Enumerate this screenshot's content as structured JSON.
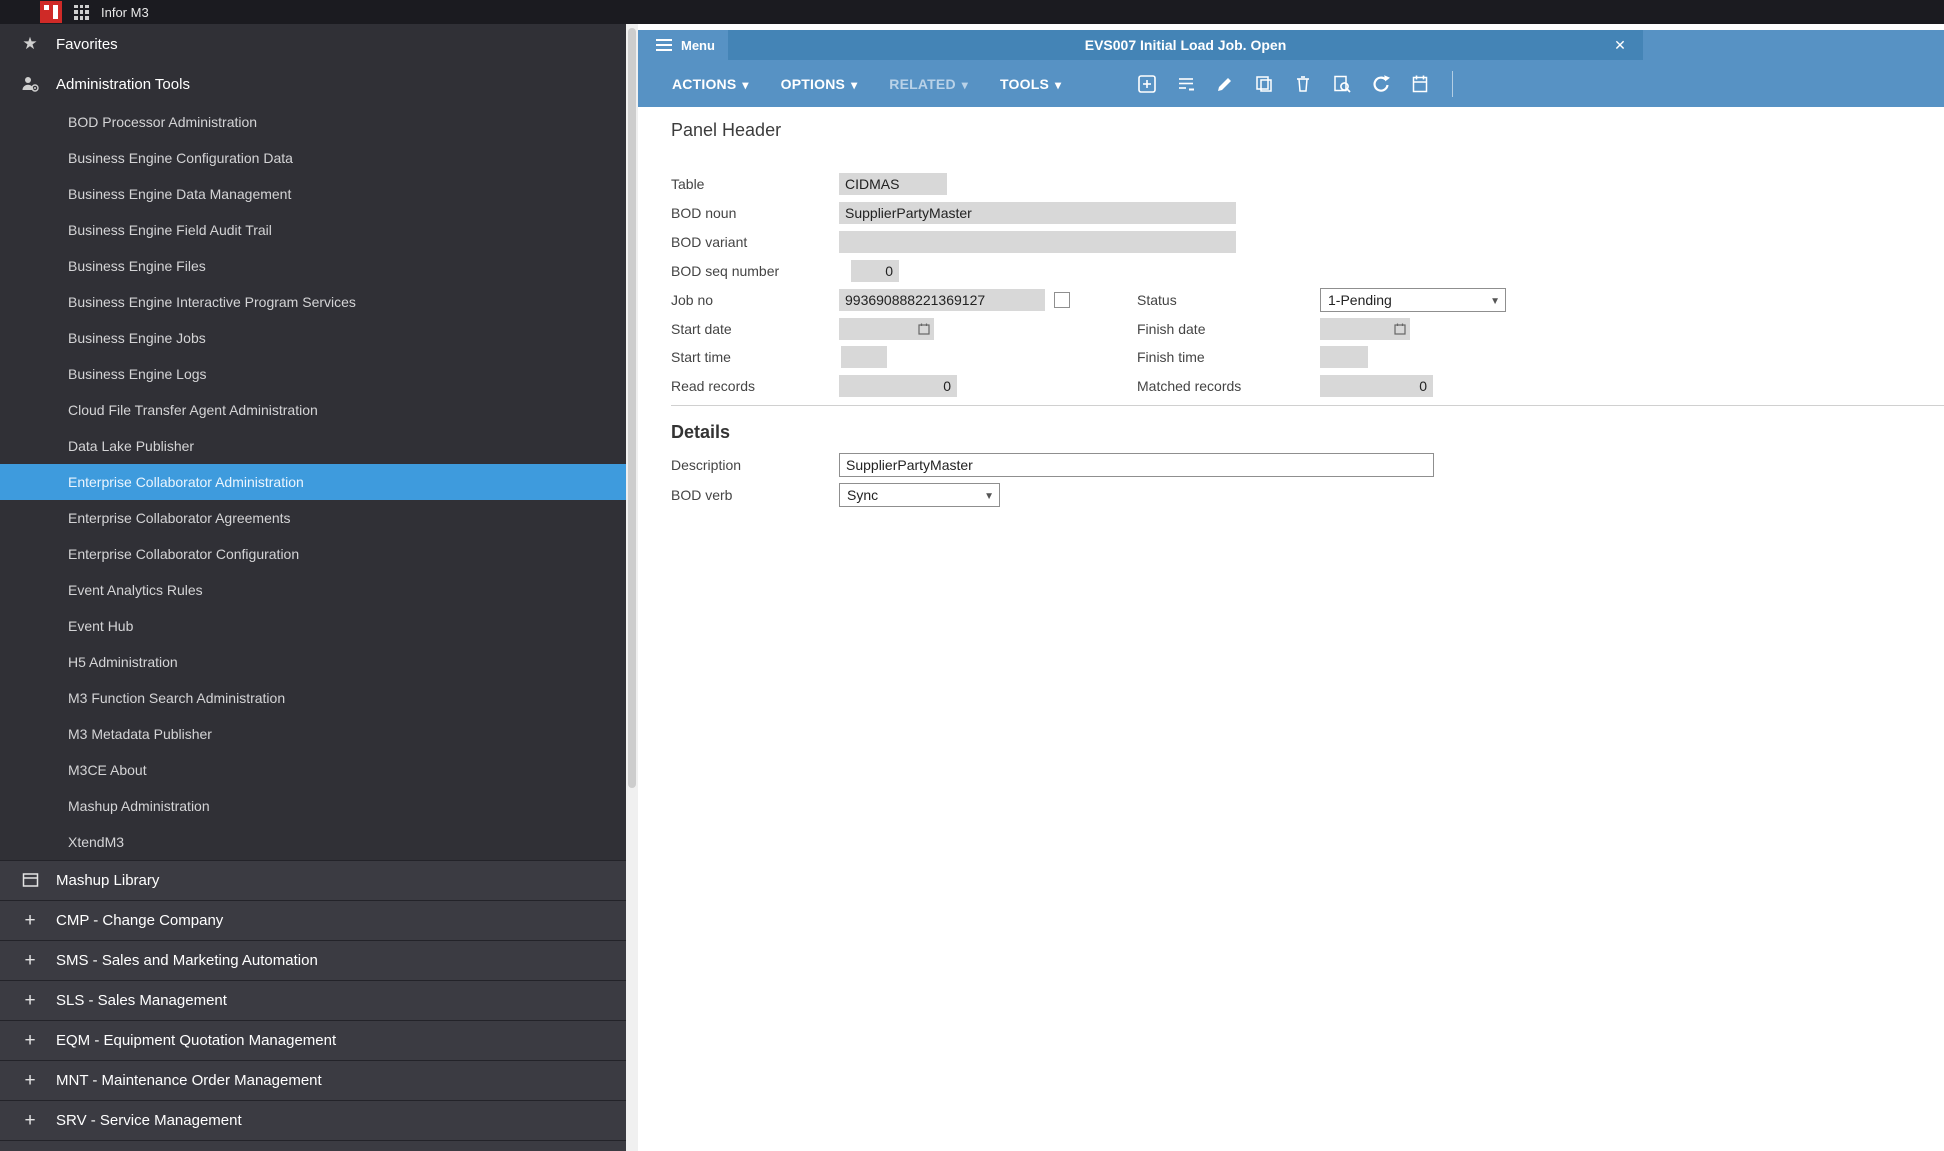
{
  "topbar": {
    "app_title": "Infor M3"
  },
  "sidebar": {
    "favorites": "Favorites",
    "admin_tools": "Administration Tools",
    "admin_items": [
      "BOD Processor Administration",
      "Business Engine Configuration Data",
      "Business Engine Data Management",
      "Business Engine Field Audit Trail",
      "Business Engine Files",
      "Business Engine Interactive Program Services",
      "Business Engine Jobs",
      "Business Engine Logs",
      "Cloud File Transfer Agent Administration",
      "Data Lake Publisher",
      "Enterprise Collaborator Administration",
      "Enterprise Collaborator Agreements",
      "Enterprise Collaborator Configuration",
      "Event Analytics Rules",
      "Event Hub",
      "H5 Administration",
      "M3 Function Search Administration",
      "M3 Metadata Publisher",
      "M3CE About",
      "Mashup Administration",
      "XtendM3"
    ],
    "sections": [
      "Mashup Library",
      "CMP - Change Company",
      "SMS - Sales and Marketing Automation",
      "SLS - Sales Management",
      "EQM - Equipment Quotation Management",
      "MNT - Maintenance Order Management",
      "SRV - Service Management"
    ]
  },
  "panel": {
    "menu": "Menu",
    "title": "EVS007 Initial Load Job. Open",
    "toolbar": {
      "actions": "ACTIONS",
      "options": "OPTIONS",
      "related": "RELATED",
      "tools": "TOOLS"
    },
    "sections": {
      "panel_header": "Panel Header",
      "details": "Details"
    },
    "fields": {
      "table_label": "Table",
      "table_value": "CIDMAS",
      "bod_noun_label": "BOD noun",
      "bod_noun_value": "SupplierPartyMaster",
      "bod_variant_label": "BOD variant",
      "bod_variant_value": "",
      "bod_seq_label": "BOD seq number",
      "bod_seq_value": "0",
      "job_no_label": "Job no",
      "job_no_value": "993690888221369127",
      "status_label": "Status",
      "status_value": "1-Pending",
      "start_date_label": "Start date",
      "start_date_value": "",
      "finish_date_label": "Finish date",
      "finish_date_value": "",
      "start_time_label": "Start time",
      "start_time_value": "",
      "finish_time_label": "Finish time",
      "finish_time_value": "",
      "read_records_label": "Read records",
      "read_records_value": "0",
      "matched_records_label": "Matched records",
      "matched_records_value": "0",
      "description_label": "Description",
      "description_value": "SupplierPartyMaster",
      "bod_verb_label": "BOD verb",
      "bod_verb_value": "Sync"
    }
  }
}
